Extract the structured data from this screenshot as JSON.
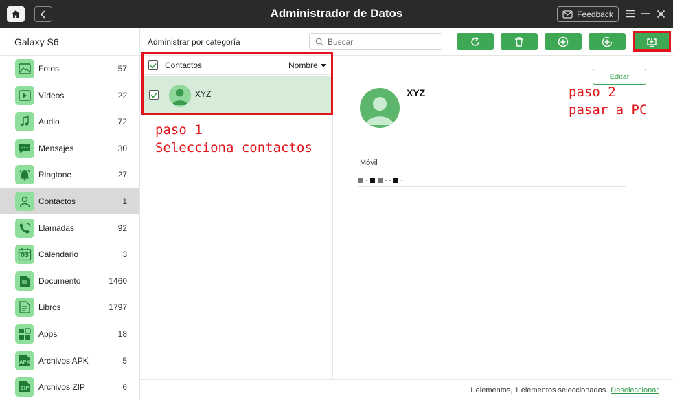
{
  "window": {
    "title": "Administrador de Datos",
    "feedback_label": "Feedback"
  },
  "device": {
    "name": "Galaxy S6"
  },
  "sidebar": {
    "items": [
      {
        "label": "Fotos",
        "count": "57",
        "icon": "photo-icon"
      },
      {
        "label": "Vídeos",
        "count": "22",
        "icon": "video-icon"
      },
      {
        "label": "Audio",
        "count": "72",
        "icon": "music-icon"
      },
      {
        "label": "Mensajes",
        "count": "30",
        "icon": "message-icon"
      },
      {
        "label": "Ringtone",
        "count": "27",
        "icon": "bell-icon"
      },
      {
        "label": "Contactos",
        "count": "1",
        "icon": "contact-icon",
        "active": true
      },
      {
        "label": "Llamadas",
        "count": "92",
        "icon": "phone-icon"
      },
      {
        "label": "Calendario",
        "count": "3",
        "icon": "calendar-icon",
        "icon_text": "03"
      },
      {
        "label": "Documento",
        "count": "1460",
        "icon": "document-icon"
      },
      {
        "label": "Libros",
        "count": "1797",
        "icon": "book-icon"
      },
      {
        "label": "Apps",
        "count": "18",
        "icon": "apps-icon"
      },
      {
        "label": "Archivos APK",
        "count": "5",
        "icon": "apk-icon",
        "icon_text": "APK"
      },
      {
        "label": "Archivos ZIP",
        "count": "6",
        "icon": "zip-icon",
        "icon_text": "ZIP"
      }
    ]
  },
  "toolbar": {
    "category_title": "Administrar por categoría",
    "search_placeholder": "Buscar",
    "actions": [
      "refresh-icon",
      "delete-icon",
      "add-icon",
      "upload-icon",
      "export-to-pc-icon"
    ]
  },
  "list": {
    "header_label": "Contactos",
    "sort_label": "Nombre",
    "items": [
      {
        "name": "XYZ",
        "checked": true
      }
    ]
  },
  "detail": {
    "edit_label": "Editar",
    "name": "XYZ",
    "phone_label": "Móvil"
  },
  "annotations": {
    "step1_line1": "paso 1",
    "step1_line2": "Selecciona contactos",
    "step2_line1": "paso 2",
    "step2_line2": "pasar a PC"
  },
  "status": {
    "text": "1 elementos, 1 elementos seleccionados.",
    "deselect_label": "Deseleccionar"
  },
  "colors": {
    "accent": "#3fa855",
    "icon_bg": "#90de9b",
    "selected_row": "#d6ecd8",
    "annotation": "#e0141a",
    "titlebar": "#2a2a2a"
  }
}
